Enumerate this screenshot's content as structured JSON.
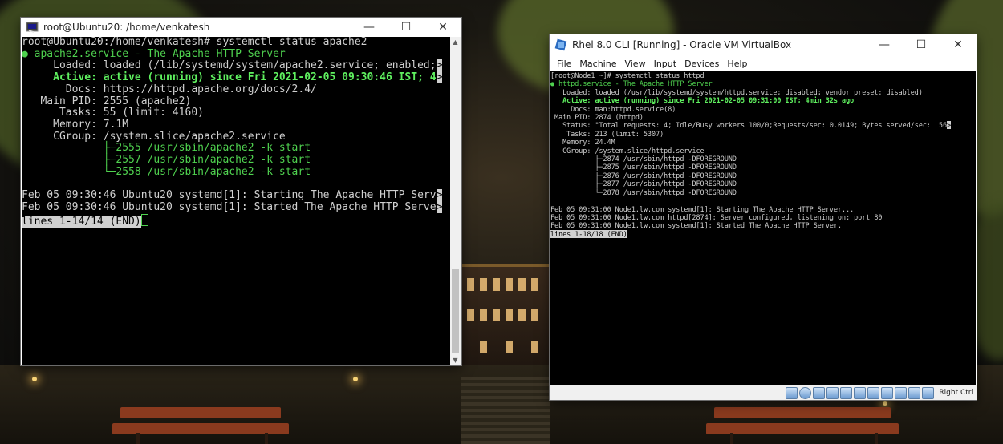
{
  "putty": {
    "title": "root@Ubuntu20: /home/venkatesh",
    "icons": {
      "app": "terminal-icon",
      "minimize": "minimize-icon",
      "maximize": "maximize-icon",
      "close": "close-icon"
    },
    "lines": [
      "root@Ubuntu20:/home/venkatesh# systemctl status apache2",
      "● apache2.service - The Apache HTTP Server",
      "     Loaded: loaded (/lib/systemd/system/apache2.service; enabled;",
      "     Active: active (running) since Fri 2021-02-05 09:30:46 IST; 4",
      "       Docs: https://httpd.apache.org/docs/2.4/",
      "   Main PID: 2555 (apache2)",
      "      Tasks: 55 (limit: 4160)",
      "     Memory: 7.1M",
      "     CGroup: /system.slice/apache2.service",
      "             ├─2555 /usr/sbin/apache2 -k start",
      "             ├─2557 /usr/sbin/apache2 -k start",
      "             └─2558 /usr/sbin/apache2 -k start",
      "",
      "Feb 05 09:30:46 Ubuntu20 systemd[1]: Starting The Apache HTTP Serv",
      "Feb 05 09:30:46 Ubuntu20 systemd[1]: Started The Apache HTTP Serve",
      "lines 1-14/14 (END)"
    ]
  },
  "vbox": {
    "title": "Rhel 8.0 CLI [Running] - Oracle VM VirtualBox",
    "menu": [
      "File",
      "Machine",
      "View",
      "Input",
      "Devices",
      "Help"
    ],
    "lines": [
      "[root@Node1 ~]# systemctl status httpd",
      "● httpd.service - The Apache HTTP Server",
      "   Loaded: loaded (/usr/lib/systemd/system/httpd.service; disabled; vendor preset: disabled)",
      "   Active: active (running) since Fri 2021-02-05 09:31:00 IST; 4min 32s ago",
      "     Docs: man:httpd.service(8)",
      " Main PID: 2874 (httpd)",
      "   Status: \"Total requests: 4; Idle/Busy workers 100/0;Requests/sec: 0.0149; Bytes served/sec:  56",
      "    Tasks: 213 (limit: 5307)",
      "   Memory: 24.4M",
      "   CGroup: /system.slice/httpd.service",
      "           ├─2874 /usr/sbin/httpd -DFOREGROUND",
      "           ├─2875 /usr/sbin/httpd -DFOREGROUND",
      "           ├─2876 /usr/sbin/httpd -DFOREGROUND",
      "           ├─2877 /usr/sbin/httpd -DFOREGROUND",
      "           └─2878 /usr/sbin/httpd -DFOREGROUND",
      "",
      "Feb 05 09:31:00 Node1.lw.com systemd[1]: Starting The Apache HTTP Server...",
      "Feb 05 09:31:00 Node1.lw.com httpd[2874]: Server configured, listening on: port 80",
      "Feb 05 09:31:00 Node1.lw.com systemd[1]: Started The Apache HTTP Server.",
      "lines 1-18/18 (END)"
    ],
    "status_host_key": "Right Ctrl"
  },
  "colors": {
    "terminal_bg": "#000000",
    "terminal_fg": "#d0d0d0",
    "active_green": "#5ff05f"
  }
}
